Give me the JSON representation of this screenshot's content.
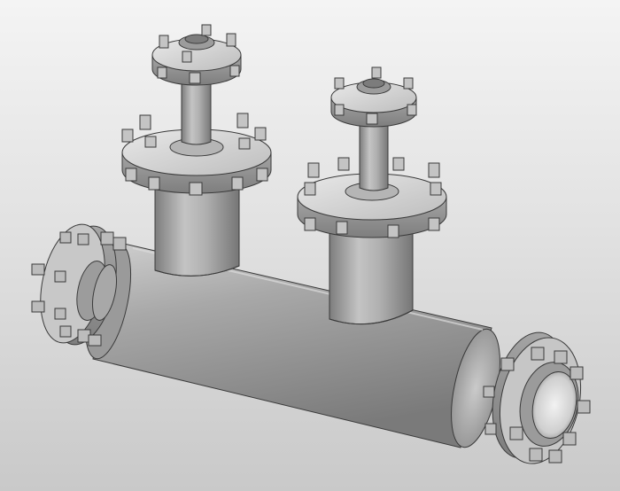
{
  "scene": {
    "background_top": "#f4f4f4",
    "background_bottom": "#c9c9c9",
    "steel_light": "#e6e6e6",
    "steel_mid": "#a9a9a9",
    "steel_dark": "#6f6f6f",
    "edge": "#3a3a3a"
  },
  "components": [
    "main-pipe",
    "left-flange",
    "right-flange",
    "left-branch-nozzle",
    "right-branch-nozzle",
    "left-top-flange",
    "right-top-flange"
  ]
}
